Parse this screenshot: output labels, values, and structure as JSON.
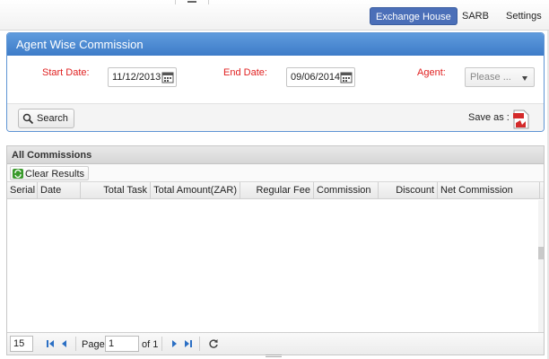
{
  "nav": {
    "items": [
      "Exchange House",
      "SARB",
      "Settings"
    ]
  },
  "panel": {
    "title": "Agent Wise Commission",
    "start_date_label": "Start Date:",
    "start_date_value": "11/12/2013",
    "end_date_label": "End Date:",
    "end_date_value": "09/06/2014",
    "agent_label": "Agent:",
    "agent_placeholder": "Please ...",
    "search_label": "Search",
    "save_as_label": "Save as :"
  },
  "grid": {
    "title": "All Commissions",
    "clear_label": "Clear Results",
    "columns": [
      "Serial",
      "Date",
      "Total Task",
      "Total Amount(ZAR)",
      "Regular Fee",
      "Commission",
      "Discount",
      "Net Commission"
    ]
  },
  "pager": {
    "page_size": "15",
    "page_label": "Page",
    "page_value": "1",
    "of_label": "of 1"
  },
  "colors": {
    "accent": "#4b6fb8",
    "panel_header": "#3e7cc8",
    "label_red": "#e02020"
  }
}
